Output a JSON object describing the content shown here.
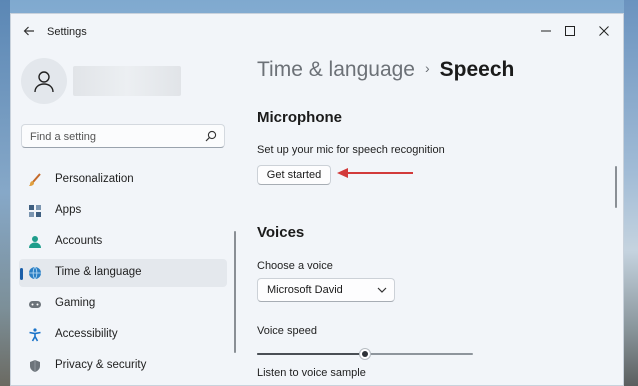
{
  "window": {
    "title": "Settings"
  },
  "search": {
    "placeholder": "Find a setting"
  },
  "sidebar": {
    "items": [
      {
        "label": "Personalization",
        "icon": "brush-icon",
        "color": "#c46a2b"
      },
      {
        "label": "Apps",
        "icon": "apps-icon",
        "color": "#4a6a8a"
      },
      {
        "label": "Accounts",
        "icon": "person-icon",
        "color": "#1f9d8c"
      },
      {
        "label": "Time & language",
        "icon": "globe-clock-icon",
        "color": "#2b7fc4",
        "selected": true
      },
      {
        "label": "Gaming",
        "icon": "gamepad-icon",
        "color": "#6c737a"
      },
      {
        "label": "Accessibility",
        "icon": "accessibility-icon",
        "color": "#1a73c9"
      },
      {
        "label": "Privacy & security",
        "icon": "shield-icon",
        "color": "#6c737a"
      }
    ]
  },
  "breadcrumb": {
    "parent": "Time & language",
    "separator": "›",
    "current": "Speech"
  },
  "microphone": {
    "title": "Microphone",
    "description": "Set up your mic for speech recognition",
    "button_label": "Get started"
  },
  "voices": {
    "title": "Voices",
    "choose_label": "Choose a voice",
    "selected_voice": "Microsoft David",
    "speed_label": "Voice speed",
    "speed_level": 0.5,
    "sample_label": "Listen to voice sample"
  },
  "colors": {
    "accent": "#1a5ea8",
    "annotation_arrow": "#d23a3a"
  }
}
